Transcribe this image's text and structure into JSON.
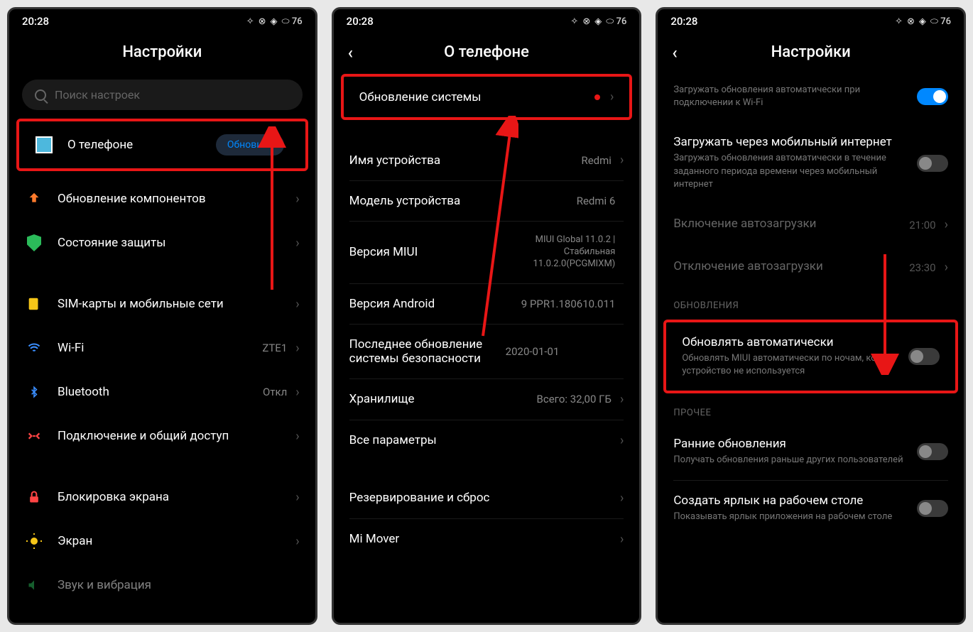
{
  "status": {
    "time": "20:28",
    "battery": "76"
  },
  "screen1": {
    "title": "Настройки",
    "search_placeholder": "Поиск настроек",
    "items": [
      {
        "label": "О телефоне",
        "badge": "Обновить"
      },
      {
        "label": "Обновление компонентов"
      },
      {
        "label": "Состояние защиты"
      },
      {
        "label": "SIM-карты и мобильные сети"
      },
      {
        "label": "Wi-Fi",
        "value": "ZTE1"
      },
      {
        "label": "Bluetooth",
        "value": "Откл"
      },
      {
        "label": "Подключение и общий доступ"
      },
      {
        "label": "Блокировка экрана"
      },
      {
        "label": "Экран"
      },
      {
        "label": "Звук и вибрация"
      }
    ]
  },
  "screen2": {
    "title": "О телефоне",
    "items": [
      {
        "label": "Обновление системы"
      },
      {
        "label": "Имя устройства",
        "value": "Redmi"
      },
      {
        "label": "Модель устройства",
        "value": "Redmi 6"
      },
      {
        "label": "Версия MIUI",
        "value": "MIUI Global 11.0.2 | Стабильная 11.0.2.0(PCGMIXM)"
      },
      {
        "label": "Версия Android",
        "value": "9 PPR1.180610.011"
      },
      {
        "label": "Последнее обновление системы безопасности",
        "value": "2020-01-01"
      },
      {
        "label": "Хранилище",
        "value": "Всего: 32,00 ГБ"
      },
      {
        "label": "Все параметры"
      },
      {
        "label": "Резервирование и сброс"
      },
      {
        "label": "Mi Mover"
      }
    ]
  },
  "screen3": {
    "title": "Настройки",
    "items": [
      {
        "title": "",
        "sub": "Загружать обновления автоматически при подключении к Wi-Fi",
        "toggle": true
      },
      {
        "title": "Загружать через мобильный интернет",
        "sub": "Загружать обновления автоматически в течение заданного периода времени через мобильный интернет",
        "toggle": false
      },
      {
        "title": "Включение автозагрузки",
        "value": "21:00"
      },
      {
        "title": "Отключение автозагрузки",
        "value": "23:30"
      }
    ],
    "section_updates": "ОБНОВЛЕНИЯ",
    "auto_update": {
      "title": "Обновлять автоматически",
      "sub": "Обновлять MIUI автоматически по ночам, когда устройство не используется",
      "toggle": false
    },
    "section_other": "ПРОЧЕЕ",
    "early": {
      "title": "Ранние обновления",
      "sub": "Получать обновления раньше других пользователей",
      "toggle": false
    },
    "shortcut": {
      "title": "Создать ярлык на рабочем столе",
      "sub": "Показывать ярлык приложения на рабочем столе",
      "toggle": false
    }
  }
}
